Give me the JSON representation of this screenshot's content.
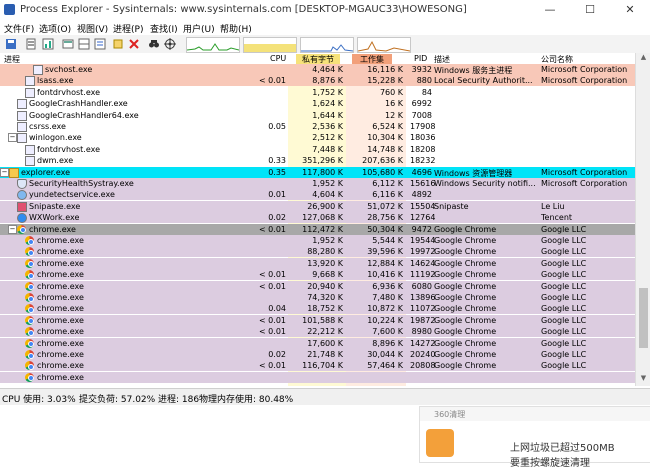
{
  "window": {
    "title": "Process Explorer - Sysinternals: www.sysinternals.com [DESKTOP-MGAUC33\\HOWESONG]",
    "minimize": "—",
    "maximize": "☐",
    "close": "✕"
  },
  "menu": [
    "文件(F)",
    "选项(O)",
    "视图(V)",
    "进程(P)",
    "查找(I)",
    "用户(U)",
    "帮助(H)"
  ],
  "header": {
    "process": "进程",
    "cpu": "CPU",
    "private_bytes": "私有字节",
    "working_set": "工作集",
    "pid": "PID",
    "description": "描述",
    "company": "公司名称"
  },
  "colors": {
    "service": "#f8c8b8",
    "own": "#c4f0f8",
    "highlight": "#00e4f8",
    "user": "#dccce0",
    "selected": "#a8a8a8"
  },
  "rows": [
    {
      "name": "svchost.exe",
      "cpu": "",
      "priv": "4,464 K",
      "ws": "16,116 K",
      "pid": "3932",
      "desc": "Windows 服务主进程",
      "company": "Microsoft Corporation",
      "style": "service",
      "indent": 3,
      "icon": "window-icon"
    },
    {
      "name": "lsass.exe",
      "cpu": "< 0.01",
      "priv": "8,876 K",
      "ws": "15,228 K",
      "pid": "880",
      "desc": "Local Security Authorit...",
      "company": "Microsoft Corporation",
      "style": "service",
      "indent": 2,
      "icon": "window-icon"
    },
    {
      "name": "fontdrvhost.exe",
      "cpu": "",
      "priv": "1,752 K",
      "ws": "760 K",
      "pid": "84",
      "desc": "",
      "company": "",
      "style": "none",
      "indent": 2,
      "icon": "window-icon"
    },
    {
      "name": "GoogleCrashHandler.exe",
      "cpu": "",
      "priv": "1,624 K",
      "ws": "16 K",
      "pid": "6992",
      "desc": "",
      "company": "",
      "style": "none",
      "indent": 1,
      "icon": "window-icon"
    },
    {
      "name": "GoogleCrashHandler64.exe",
      "cpu": "",
      "priv": "1,644 K",
      "ws": "12 K",
      "pid": "7008",
      "desc": "",
      "company": "",
      "style": "none",
      "indent": 1,
      "icon": "window-icon"
    },
    {
      "name": "csrss.exe",
      "cpu": "0.05",
      "priv": "2,536 K",
      "ws": "6,524 K",
      "pid": "17908",
      "desc": "",
      "company": "",
      "style": "none",
      "indent": 1,
      "icon": "window-icon"
    },
    {
      "name": "winlogon.exe",
      "cpu": "",
      "priv": "2,512 K",
      "ws": "10,304 K",
      "pid": "18036",
      "desc": "",
      "company": "",
      "style": "none",
      "indent": 1,
      "icon": "window-icon",
      "expander": "−"
    },
    {
      "name": "fontdrvhost.exe",
      "cpu": "",
      "priv": "7,448 K",
      "ws": "14,748 K",
      "pid": "18208",
      "desc": "",
      "company": "",
      "style": "none",
      "indent": 2,
      "icon": "window-icon"
    },
    {
      "name": "dwm.exe",
      "cpu": "0.33",
      "priv": "351,296 K",
      "ws": "207,636 K",
      "pid": "18232",
      "desc": "",
      "company": "",
      "style": "none",
      "indent": 2,
      "icon": "window-icon"
    },
    {
      "name": "explorer.exe",
      "cpu": "0.35",
      "priv": "117,800 K",
      "ws": "105,680 K",
      "pid": "4696",
      "desc": "Windows 资源管理器",
      "company": "Microsoft Corporation",
      "style": "highlight",
      "indent": 0,
      "icon": "folder-icon",
      "expander": "−"
    },
    {
      "name": "SecurityHealthSystray.exe",
      "cpu": "",
      "priv": "1,952 K",
      "ws": "6,112 K",
      "pid": "15616",
      "desc": "Windows Security notifi...",
      "company": "Microsoft Corporation",
      "style": "user",
      "indent": 1,
      "icon": "shield-icon"
    },
    {
      "name": "yundetectservice.exe",
      "cpu": "0.01",
      "priv": "4,604 K",
      "ws": "6,116 K",
      "pid": "4892",
      "desc": "",
      "company": "",
      "style": "user",
      "indent": 1,
      "icon": "cloud-icon"
    },
    {
      "name": "Snipaste.exe",
      "cpu": "",
      "priv": "26,900 K",
      "ws": "51,072 K",
      "pid": "15504",
      "desc": "Snipaste",
      "company": "Le Liu",
      "style": "user",
      "indent": 1,
      "icon": "snip-icon"
    },
    {
      "name": "WXWork.exe",
      "cpu": "0.02",
      "priv": "127,068 K",
      "ws": "28,756 K",
      "pid": "12764",
      "desc": "",
      "company": "Tencent",
      "style": "user",
      "indent": 1,
      "icon": "wxwork-icon"
    },
    {
      "name": "chrome.exe",
      "cpu": "< 0.01",
      "priv": "112,472 K",
      "ws": "50,304 K",
      "pid": "9472",
      "desc": "Google Chrome",
      "company": "Google LLC",
      "style": "selected",
      "indent": 1,
      "icon": "chrome-icon",
      "expander": "−"
    },
    {
      "name": "chrome.exe",
      "cpu": "",
      "priv": "1,952 K",
      "ws": "5,544 K",
      "pid": "19544",
      "desc": "Google Chrome",
      "company": "Google LLC",
      "style": "user",
      "indent": 2,
      "icon": "chrome-icon"
    },
    {
      "name": "chrome.exe",
      "cpu": "",
      "priv": "88,280 K",
      "ws": "39,596 K",
      "pid": "19972",
      "desc": "Google Chrome",
      "company": "Google LLC",
      "style": "user",
      "indent": 2,
      "icon": "chrome-icon"
    },
    {
      "name": "chrome.exe",
      "cpu": "",
      "priv": "13,920 K",
      "ws": "12,884 K",
      "pid": "14624",
      "desc": "Google Chrome",
      "company": "Google LLC",
      "style": "user",
      "indent": 2,
      "icon": "chrome-icon"
    },
    {
      "name": "chrome.exe",
      "cpu": "< 0.01",
      "priv": "9,668 K",
      "ws": "10,416 K",
      "pid": "11192",
      "desc": "Google Chrome",
      "company": "Google LLC",
      "style": "user",
      "indent": 2,
      "icon": "chrome-icon"
    },
    {
      "name": "chrome.exe",
      "cpu": "< 0.01",
      "priv": "20,940 K",
      "ws": "6,936 K",
      "pid": "6080",
      "desc": "Google Chrome",
      "company": "Google LLC",
      "style": "user",
      "indent": 2,
      "icon": "chrome-icon"
    },
    {
      "name": "chrome.exe",
      "cpu": "",
      "priv": "74,320 K",
      "ws": "7,480 K",
      "pid": "13896",
      "desc": "Google Chrome",
      "company": "Google LLC",
      "style": "user",
      "indent": 2,
      "icon": "chrome-icon"
    },
    {
      "name": "chrome.exe",
      "cpu": "0.04",
      "priv": "18,752 K",
      "ws": "10,872 K",
      "pid": "11072",
      "desc": "Google Chrome",
      "company": "Google LLC",
      "style": "user",
      "indent": 2,
      "icon": "chrome-icon"
    },
    {
      "name": "chrome.exe",
      "cpu": "< 0.01",
      "priv": "101,588 K",
      "ws": "10,224 K",
      "pid": "19872",
      "desc": "Google Chrome",
      "company": "Google LLC",
      "style": "user",
      "indent": 2,
      "icon": "chrome-icon"
    },
    {
      "name": "chrome.exe",
      "cpu": "< 0.01",
      "priv": "22,212 K",
      "ws": "7,600 K",
      "pid": "8980",
      "desc": "Google Chrome",
      "company": "Google LLC",
      "style": "user",
      "indent": 2,
      "icon": "chrome-icon"
    },
    {
      "name": "chrome.exe",
      "cpu": "",
      "priv": "17,600 K",
      "ws": "8,896 K",
      "pid": "14272",
      "desc": "Google Chrome",
      "company": "Google LLC",
      "style": "user",
      "indent": 2,
      "icon": "chrome-icon"
    },
    {
      "name": "chrome.exe",
      "cpu": "0.02",
      "priv": "21,748 K",
      "ws": "30,044 K",
      "pid": "20240",
      "desc": "Google Chrome",
      "company": "Google LLC",
      "style": "user",
      "indent": 2,
      "icon": "chrome-icon"
    },
    {
      "name": "chrome.exe",
      "cpu": "< 0.01",
      "priv": "116,704 K",
      "ws": "57,464 K",
      "pid": "20808",
      "desc": "Google Chrome",
      "company": "Google LLC",
      "style": "user",
      "indent": 2,
      "icon": "chrome-icon"
    },
    {
      "name": "chrome.exe",
      "cpu": "",
      "priv": "",
      "ws": "",
      "pid": "",
      "desc": "",
      "company": "",
      "style": "user",
      "indent": 2,
      "icon": "chrome-icon"
    }
  ],
  "status": {
    "cpu": "CPU 使用: 3.03%",
    "commit": "提交负荷: 57.02%",
    "processes": "进程: 186",
    "memory": "物理内存使用: 80.48%"
  },
  "popup": {
    "brand": "360清理",
    "line1": "上网垃圾已超过500MB",
    "line2": "要重按螺旋速清理"
  }
}
